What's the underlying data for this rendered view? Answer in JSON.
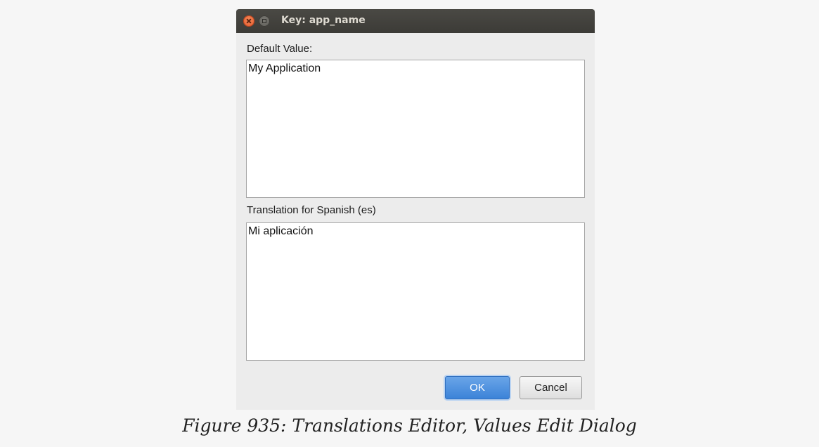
{
  "window": {
    "title": "Key: app_name",
    "close_icon": "close-icon",
    "maximize_icon": "maximize-icon"
  },
  "form": {
    "default_label": "Default Value:",
    "default_value": "My Application",
    "translation_label": "Translation for Spanish (es)",
    "translation_value": "Mi aplicación"
  },
  "buttons": {
    "ok_label": "OK",
    "cancel_label": "Cancel"
  },
  "caption": "Figure 935: Translations Editor, Values Edit Dialog",
  "colors": {
    "titlebar": "#3c3b37",
    "close": "#e2572a",
    "ok_button": "#3c83d8",
    "dialog_background": "#ececec"
  }
}
